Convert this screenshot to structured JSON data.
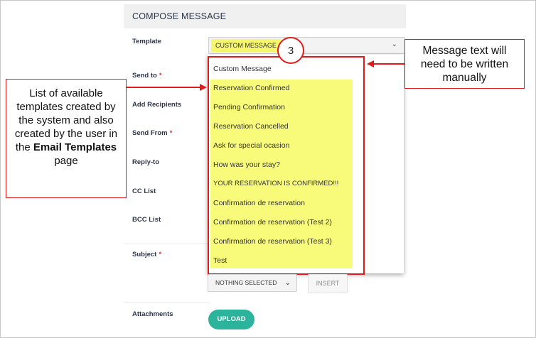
{
  "header": {
    "title": "COMPOSE MESSAGE"
  },
  "form": {
    "template_label": "Template",
    "send_to_label": "Send to",
    "add_recipients_label": "Add Recipients",
    "send_from_label": "Send From",
    "reply_to_label": "Reply-to",
    "cc_label": "CC List",
    "bcc_label": "BCC List",
    "subject_label": "Subject",
    "attachments_label": "Attachments",
    "required_mark": "*",
    "template_value": "CUSTOM MESSAGE",
    "placeholder_select_value": "NOTHING SELECTED",
    "insert_button": "INSERT",
    "upload_button": "UPLOAD"
  },
  "dropdown": {
    "items": [
      "Custom Message",
      "Reservation Confirmed",
      "Pending Confirmation",
      "Reservation Cancelled",
      "Ask for special ocasion",
      "How was your stay?",
      "YOUR RESERVATION IS CONFIRMED!!!",
      "Confirmation de reservation",
      "Confirmation de reservation (Test 2)",
      "Confirmation de reservation (Test 3)",
      "Test"
    ]
  },
  "annotations": {
    "step_number": "3",
    "left_callout_line1": "List of available templates created by the system and also created by the user in the",
    "left_callout_bold": "Email Templates",
    "left_callout_line2": "page",
    "right_callout": "Message text will need to be written manually"
  },
  "colors": {
    "highlight": "#f8fb79",
    "annotation_red": "#e01b1b",
    "upload_green": "#2bb49b"
  },
  "icons": {
    "chevron": "chevron-down-icon"
  }
}
